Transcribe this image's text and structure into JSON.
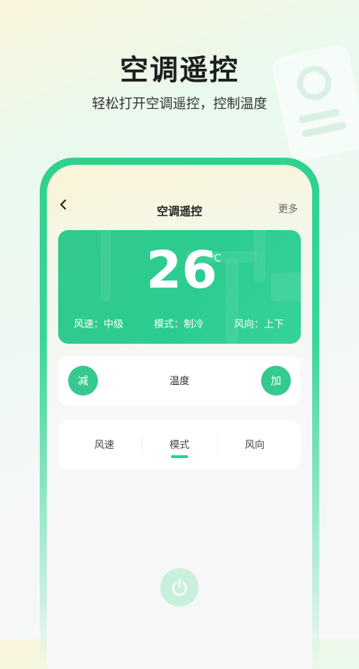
{
  "hero": {
    "title": "空调遥控",
    "subtitle": "轻松打开空调遥控，控制温度"
  },
  "nav": {
    "title": "空调遥控",
    "more_label": "更多"
  },
  "ac": {
    "temperature": "26",
    "unit": "℃",
    "fan_speed": "风速：中级",
    "mode": "模式：制冷",
    "direction": "风向：上下"
  },
  "temp_control": {
    "decrease_label": "减",
    "label": "温度",
    "increase_label": "加"
  },
  "tabs": [
    {
      "label": "风速"
    },
    {
      "label": "模式"
    },
    {
      "label": "风向"
    }
  ],
  "selected_tab": "模式",
  "colors": {
    "accent": "#35c98f",
    "card": "#2ccc90",
    "power_bg": "#c9f0dc"
  }
}
